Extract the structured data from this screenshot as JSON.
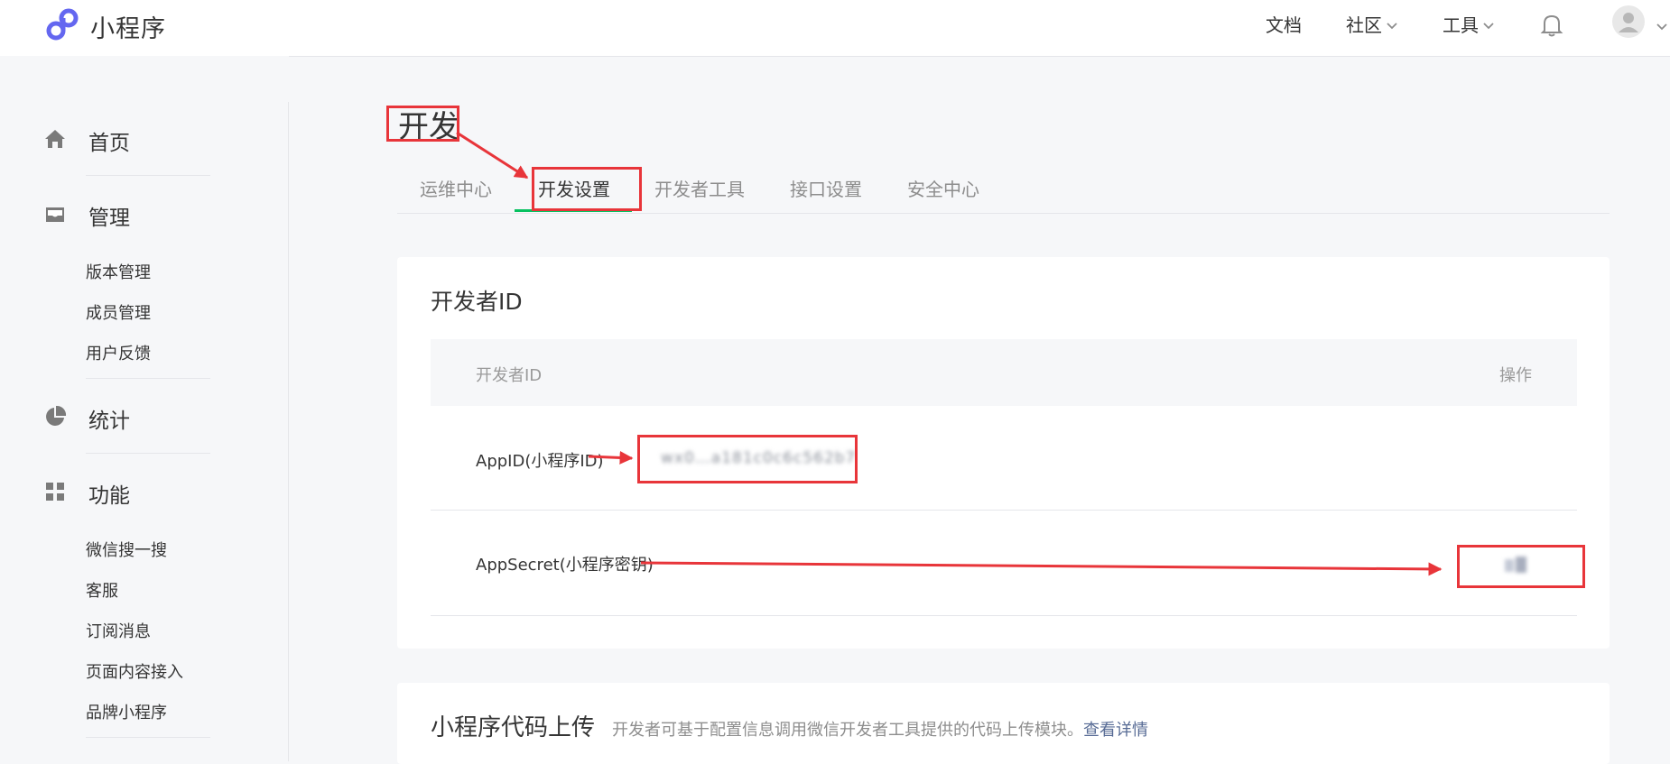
{
  "app": {
    "logo_text": "小程序",
    "brand_color": "#6467f0"
  },
  "top_nav": {
    "docs": "文档",
    "community": "社区",
    "tools": "工具"
  },
  "sidebar": {
    "home": "首页",
    "manage": "管理",
    "manage_items": [
      "版本管理",
      "成员管理",
      "用户反馈"
    ],
    "stats": "统计",
    "features": "功能",
    "feature_items": [
      "微信搜一搜",
      "客服",
      "订阅消息",
      "页面内容接入",
      "品牌小程序"
    ]
  },
  "page": {
    "title": "开发",
    "tabs": [
      "运维中心",
      "开发设置",
      "开发者工具",
      "接口设置",
      "安全中心"
    ],
    "active_tab": "开发设置"
  },
  "developer_id_card": {
    "title": "开发者ID",
    "columns": [
      "开发者ID",
      "操作"
    ],
    "rows": [
      {
        "label": "AppID(小程序ID)",
        "value": "wx0…a181c0c6c562b7"
      },
      {
        "label": "AppSecret(小程序密钥)",
        "value": ""
      }
    ]
  },
  "upload_card": {
    "title": "小程序代码上传",
    "description": "开发者可基于配置信息调用微信开发者工具提供的代码上传模块。",
    "link": "查看详情"
  },
  "colors": {
    "accent_green": "#07c160",
    "annotation_red": "#e8353a",
    "link_blue": "#576b95"
  },
  "icons": [
    "home-icon",
    "inbox-icon",
    "pie-chart-icon",
    "grid-icon",
    "bell-icon",
    "user-avatar-icon",
    "chevron-down-icon"
  ]
}
